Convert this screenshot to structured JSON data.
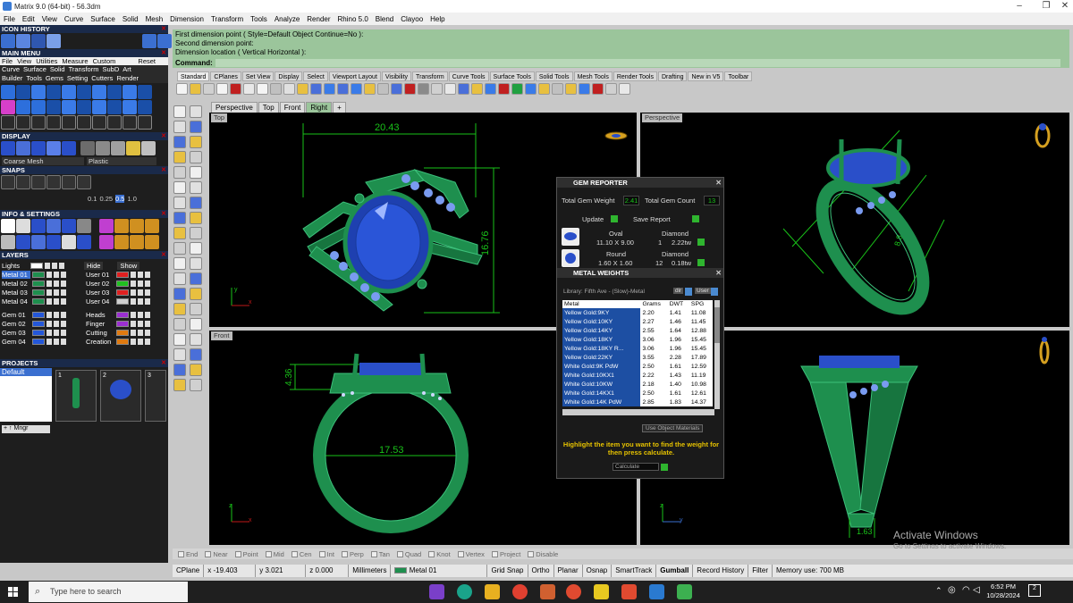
{
  "window": {
    "title": "Matrix 9.0 (64-bit) - 56.3dm",
    "controls": [
      "–",
      "❐",
      "✕"
    ]
  },
  "menu": [
    "File",
    "Edit",
    "View",
    "Curve",
    "Surface",
    "Solid",
    "Mesh",
    "Dimension",
    "Transform",
    "Tools",
    "Analyze",
    "Render",
    "Rhino 5.0",
    "Blend",
    "Clayoo",
    "Help"
  ],
  "left_panel": {
    "icon_history": "ICON HISTORY",
    "main_menu": "MAIN MENU",
    "main_menu_row": [
      "File",
      "View",
      "Utilities",
      "Measure",
      "Custom",
      "Reset"
    ],
    "main_menu_row2": [
      "Curve",
      "Surface",
      "Solid",
      "Transform",
      "SubD",
      "Art"
    ],
    "main_menu_row3": [
      "Builder",
      "Tools",
      "Gems",
      "Setting",
      "Cutters",
      "Render"
    ],
    "display": "DISPLAY",
    "display_mesh": "Coarse Mesh",
    "display_material": "Plastic",
    "snaps": "SNAPS",
    "snap_values": [
      "0.1",
      "0.25",
      "0.5",
      "1.0"
    ],
    "info_settings": "INFO & SETTINGS",
    "layers": "LAYERS",
    "layers_lights": "Lights",
    "layers_hide": "Hide",
    "layers_show": "Show",
    "layer_rows_left": [
      {
        "name": "Metal 01",
        "color": "#1e8f4e",
        "selected": true
      },
      {
        "name": "Metal 02",
        "color": "#1e8f4e"
      },
      {
        "name": "Metal 03",
        "color": "#1e8f4e"
      },
      {
        "name": "Metal 04",
        "color": "#1e8f4e"
      },
      {
        "name": "Gem 01",
        "color": "#2457d9"
      },
      {
        "name": "Gem 02",
        "color": "#2457d9"
      },
      {
        "name": "Gem 03",
        "color": "#2457d9"
      },
      {
        "name": "Gem 04",
        "color": "#2457d9"
      }
    ],
    "layer_rows_right": [
      {
        "name": "User 01",
        "color": "#e02020"
      },
      {
        "name": "User 02",
        "color": "#20c020"
      },
      {
        "name": "User 03",
        "color": "#e02020"
      },
      {
        "name": "User 04",
        "color": "#d0d0d0"
      },
      {
        "name": "Heads",
        "color": "#9b2fd1"
      },
      {
        "name": "Finger",
        "color": "#9b2fd1"
      },
      {
        "name": "Cutting",
        "color": "#e07a10"
      },
      {
        "name": "Creation",
        "color": "#e07a10"
      }
    ],
    "projects": "PROJECTS",
    "project_default": "Default",
    "project_thumbs": [
      "1",
      "2",
      "3"
    ],
    "mngr": "Mngr"
  },
  "command": {
    "lines": [
      "First dimension point ( Style=Default  Object  Continue=No ):",
      "Second dimension point:",
      "Dimension location ( Vertical  Horizontal ):"
    ],
    "prompt": "Command:"
  },
  "toolbar_tabs": [
    "Standard",
    "CPlanes",
    "Set View",
    "Display",
    "Select",
    "Viewport Layout",
    "Visibility",
    "Transform",
    "Curve Tools",
    "Surface Tools",
    "Solid Tools",
    "Mesh Tools",
    "Render Tools",
    "Drafting",
    "New in V5",
    "Toolbar"
  ],
  "viewport_tabs": [
    "Perspective",
    "Top",
    "Front",
    "Right"
  ],
  "viewports": {
    "top_label": "Top",
    "perspective_label": "Perspective",
    "front_label": "Front",
    "top_dim_width": "20.43",
    "top_dim_height": "16.76",
    "front_dim_height": "4.36",
    "front_dim_diameter": "17.53",
    "persp_dim": "8.8",
    "right_dim": "1.63"
  },
  "gem_reporter": {
    "title": "GEM REPORTER",
    "total_weight_label": "Total Gem Weight",
    "total_weight": "2.41",
    "total_count_label": "Total Gem Count",
    "total_count": "13",
    "update": "Update",
    "save_report": "Save Report",
    "gems": [
      {
        "shape": "Oval",
        "dims": "11.10 X 9.00",
        "type": "Diamond",
        "count": "1",
        "weight": "2.22tw"
      },
      {
        "shape": "Round",
        "dims": "1.60 X 1.60",
        "type": "Diamond",
        "count": "12",
        "weight": "0.18tw"
      }
    ]
  },
  "metal_weights": {
    "title": "METAL WEIGHTS",
    "library": "Library: Fifth Ave - (Slow)-Metal",
    "lib_btn1": "dir",
    "lib_btn2": "User",
    "headers": [
      "Metal",
      "Grams",
      "DWT",
      "SPG"
    ],
    "rows": [
      [
        "Yellow Gold:9KY",
        "2.20",
        "1.41",
        "11.08"
      ],
      [
        "Yellow Gold:10KY",
        "2.27",
        "1.46",
        "11.45"
      ],
      [
        "Yellow Gold:14KY",
        "2.55",
        "1.64",
        "12.88"
      ],
      [
        "Yellow Gold:18KY",
        "3.06",
        "1.96",
        "15.45"
      ],
      [
        "Yellow Gold:18KY R...",
        "3.06",
        "1.96",
        "15.45"
      ],
      [
        "Yellow Gold:22KY",
        "3.55",
        "2.28",
        "17.89"
      ],
      [
        "White Gold:9K PdW",
        "2.50",
        "1.61",
        "12.59"
      ],
      [
        "White Gold:10KX1",
        "2.22",
        "1.43",
        "11.19"
      ],
      [
        "White Gold:10KW",
        "2.18",
        "1.40",
        "10.98"
      ],
      [
        "White Gold:14KX1",
        "2.50",
        "1.61",
        "12.61"
      ],
      [
        "White Gold:14K PdW",
        "2.85",
        "1.83",
        "14.37"
      ]
    ],
    "use_object_materials": "Use Object Materials",
    "note": "Highlight the item you want to find the weight for then press calculate.",
    "calculate": "Calculate"
  },
  "snap_bar": [
    "End",
    "Near",
    "Point",
    "Mid",
    "Cen",
    "Int",
    "Perp",
    "Tan",
    "Quad",
    "Knot",
    "Vertex",
    "Project",
    "Disable"
  ],
  "status_bar": {
    "cplane": "CPlane",
    "x": "x -19.403",
    "y": "y 3.021",
    "z": "z 0.000",
    "units": "Millimeters",
    "layer": "Metal 01",
    "layer_color": "#1e8f4e",
    "items": [
      "Grid Snap",
      "Ortho",
      "Planar",
      "Osnap",
      "SmartTrack",
      "Gumball",
      "Record History",
      "Filter"
    ],
    "memory": "Memory use: 700 MB"
  },
  "watermark": {
    "line1": "Activate Windows",
    "line2": "Go to Settings to activate Windows."
  },
  "taskbar": {
    "search_placeholder": "Type here to search",
    "time": "6:52 PM",
    "date": "10/28/2024"
  },
  "colors": {
    "metal": "#1e8f4e",
    "gem": "#2a4fc9",
    "dimension": "#19c219",
    "command_bg": "#9bc59b"
  }
}
